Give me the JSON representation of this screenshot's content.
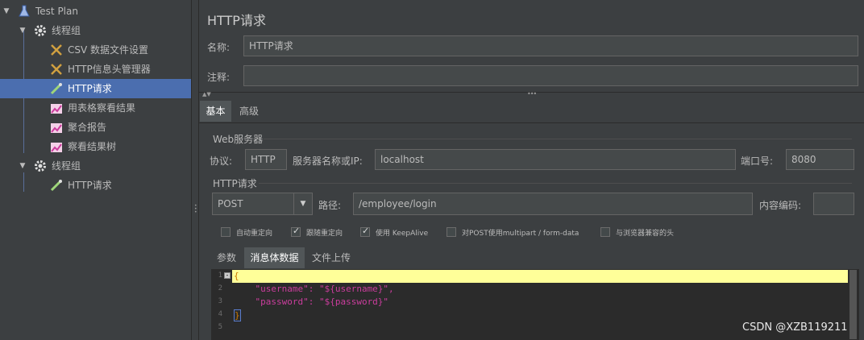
{
  "tree": {
    "items": [
      {
        "label": "Test Plan"
      },
      {
        "label": "线程组"
      },
      {
        "label": "CSV 数据文件设置"
      },
      {
        "label": "HTTP信息头管理器"
      },
      {
        "label": "HTTP请求"
      },
      {
        "label": "用表格察看结果"
      },
      {
        "label": "聚合报告"
      },
      {
        "label": "察看结果树"
      },
      {
        "label": "线程组"
      },
      {
        "label": "HTTP请求"
      }
    ]
  },
  "panel": {
    "title": "HTTP请求",
    "name_label": "名称:",
    "name_value": "HTTP请求",
    "comment_label": "注释:",
    "comment_value": ""
  },
  "tabs": [
    {
      "label": "基本"
    },
    {
      "label": "高级"
    }
  ],
  "web_server": {
    "section": "Web服务器",
    "protocol_label": "协议:",
    "protocol_value": "HTTP",
    "server_label": "服务器名称或IP:",
    "server_value": "localhost",
    "port_label": "端口号:",
    "port_value": "8080"
  },
  "http_request": {
    "section": "HTTP请求",
    "method": "POST",
    "path_label": "路径:",
    "path_value": "/employee/login",
    "encoding_label": "内容编码:",
    "encoding_value": ""
  },
  "options": [
    {
      "label": "自动重定向",
      "checked": false
    },
    {
      "label": "跟随重定向",
      "checked": true
    },
    {
      "label": "使用 KeepAlive",
      "checked": true
    },
    {
      "label": "对POST使用multipart / form-data",
      "checked": false
    },
    {
      "label": "与浏览器兼容的头",
      "checked": false
    }
  ],
  "subtabs": [
    {
      "label": "参数"
    },
    {
      "label": "消息体数据"
    },
    {
      "label": "文件上传"
    }
  ],
  "editor": {
    "line_numbers": [
      "1",
      "2",
      "3",
      "4",
      "5"
    ],
    "lines": [
      "{",
      "    \"username\": \"${username}\",",
      "    \"password\": \"${password}\"",
      "}",
      ""
    ]
  },
  "watermark": "CSDN @XZB119211",
  "colors": {
    "accent": "#4b6eaf",
    "highlight": "#ffff99",
    "string": "#cc3d9e"
  }
}
